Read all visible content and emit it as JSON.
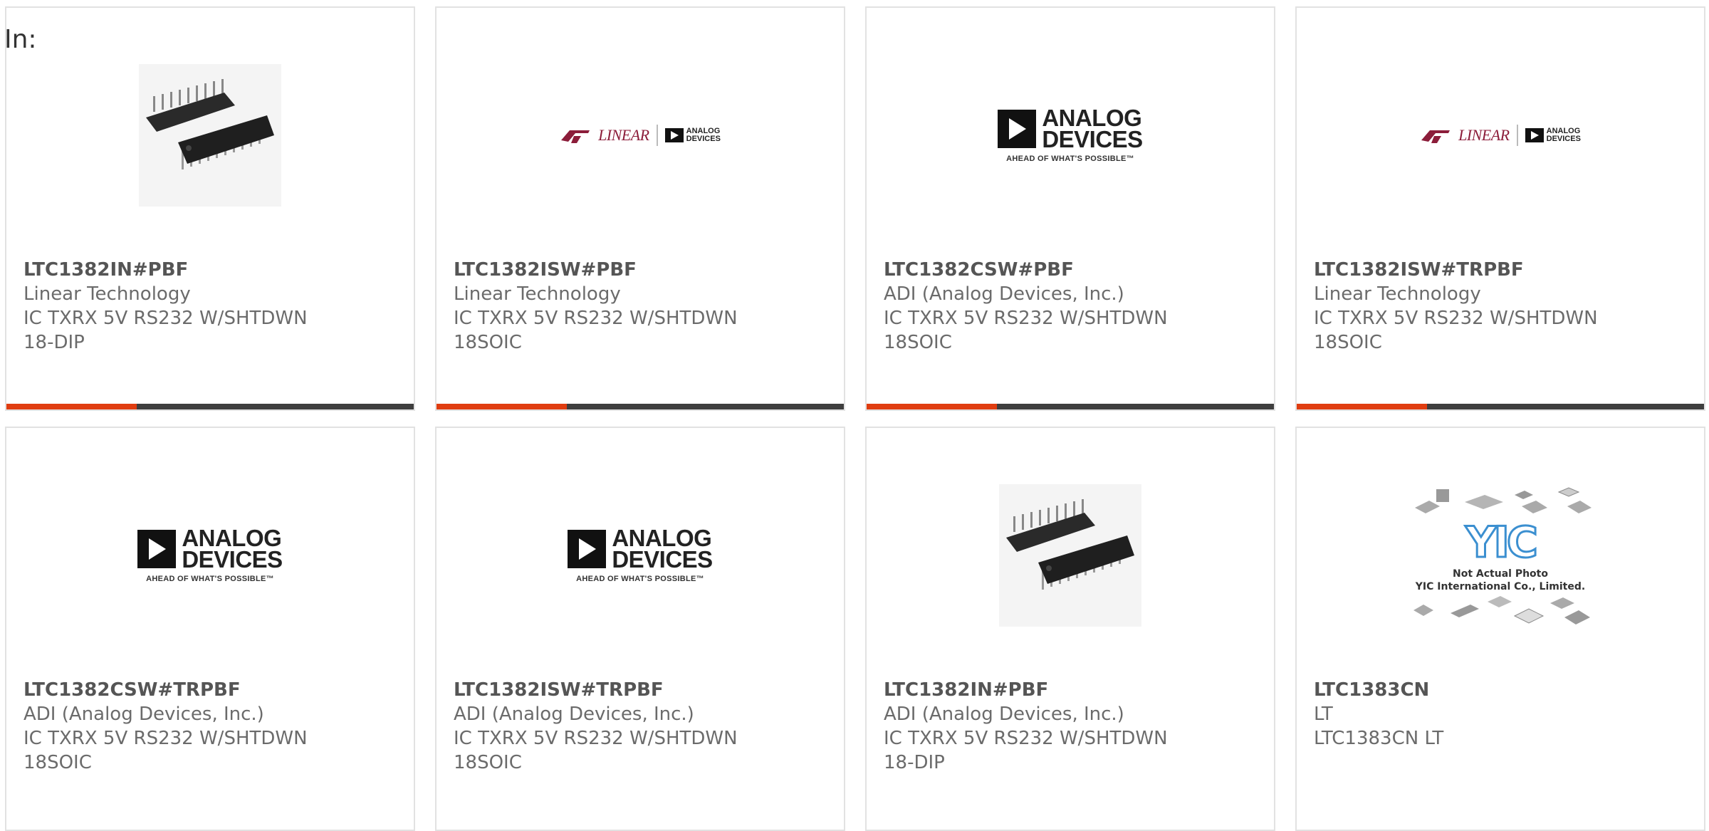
{
  "page": {
    "in_label": "In:"
  },
  "colors": {
    "accent": "#e03d10",
    "bar": "#3e3e3e",
    "border": "#e2e2e2"
  },
  "products": [
    {
      "part": "LTC1382IN#PBF",
      "manufacturer": "Linear Technology",
      "description": "IC TXRX 5V RS232 W/SHTDWN",
      "package": "18-DIP",
      "image": "dip-chip-photo",
      "progress": 0.32
    },
    {
      "part": "LTC1382ISW#PBF",
      "manufacturer": "Linear Technology",
      "description": "IC TXRX 5V RS232 W/SHTDWN",
      "package": "18SOIC",
      "image": "linear-adi-logo",
      "progress": 0.32
    },
    {
      "part": "LTC1382CSW#PBF",
      "manufacturer": "ADI (Analog Devices, Inc.)",
      "description": "IC TXRX 5V RS232 W/SHTDWN",
      "package": "18SOIC",
      "image": "analog-devices-logo",
      "progress": 0.32
    },
    {
      "part": "LTC1382ISW#TRPBF",
      "manufacturer": "Linear Technology",
      "description": "IC TXRX 5V RS232 W/SHTDWN",
      "package": "18SOIC",
      "image": "linear-adi-logo",
      "progress": 0.32
    },
    {
      "part": "LTC1382CSW#TRPBF",
      "manufacturer": "ADI (Analog Devices, Inc.)",
      "description": "IC TXRX 5V RS232 W/SHTDWN",
      "package": "18SOIC",
      "image": "analog-devices-logo"
    },
    {
      "part": "LTC1382ISW#TRPBF",
      "manufacturer": "ADI (Analog Devices, Inc.)",
      "description": "IC TXRX 5V RS232 W/SHTDWN",
      "package": "18SOIC",
      "image": "analog-devices-logo"
    },
    {
      "part": "LTC1382IN#PBF",
      "manufacturer": "ADI (Analog Devices, Inc.)",
      "description": "IC TXRX 5V RS232 W/SHTDWN",
      "package": "18-DIP",
      "image": "dip-chip-photo"
    },
    {
      "part": "LTC1383CN",
      "manufacturer": "LT",
      "description": "LTC1383CN LT",
      "package": "",
      "image": "yic-placeholder"
    }
  ],
  "logos": {
    "linear_word": "LINEAR",
    "adi_words": [
      "ANALOG",
      "DEVICES"
    ],
    "adi_tagline": "AHEAD OF WHAT'S POSSIBLE™",
    "yic_mark": "YIC",
    "yic_caption": [
      "Not Actual Photo",
      "YIC International Co., Limited."
    ]
  }
}
